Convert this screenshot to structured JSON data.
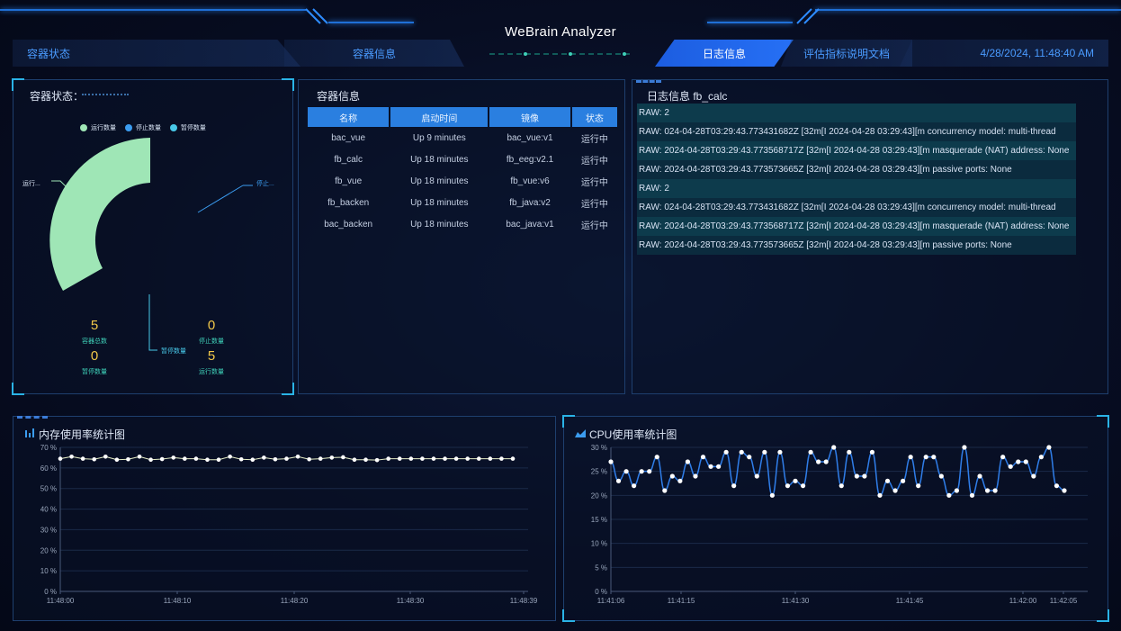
{
  "header": {
    "title": "WeBrain Analyzer",
    "datetime": "4/28/2024, 11:48:40 AM",
    "tabs": [
      {
        "label": "容器状态"
      },
      {
        "label": "容器信息"
      },
      {
        "label": "日志信息"
      },
      {
        "label": "评估指标说明文档"
      }
    ],
    "active_tab": "日志信息"
  },
  "status_panel": {
    "title": "容器状态：",
    "legend": [
      {
        "label": "运行数量",
        "color": "#9fe6b6"
      },
      {
        "label": "停止数量",
        "color": "#3b9cf0"
      },
      {
        "label": "暂停数量",
        "color": "#48c8e8"
      }
    ],
    "pie_labels": {
      "running": "运行...",
      "stopped": "停止..."
    },
    "chart_data": {
      "type": "pie",
      "categories": [
        "运行数量",
        "停止数量",
        "暂停数量"
      ],
      "values": [
        5,
        0,
        0
      ]
    },
    "stats": [
      {
        "value": "5",
        "label": "容器总数"
      },
      {
        "value": "0",
        "label": "停止数量"
      },
      {
        "value": "0",
        "label": "暂停数量"
      },
      {
        "value": "5",
        "label": "运行数量"
      }
    ],
    "paused_callout": "暂停数量"
  },
  "info_panel": {
    "title": "容器信息",
    "columns": [
      "名称",
      "启动时间",
      "镜像",
      "状态"
    ],
    "rows": [
      [
        "bac_vue",
        "Up 9 minutes",
        "bac_vue:v1",
        "运行中"
      ],
      [
        "fb_calc",
        "Up 18 minutes",
        "fb_eeg:v2.1",
        "运行中"
      ],
      [
        "fb_vue",
        "Up 18 minutes",
        "fb_vue:v6",
        "运行中"
      ],
      [
        "fb_backen",
        "Up 18 minutes",
        "fb_java:v2",
        "运行中"
      ],
      [
        "bac_backen",
        "Up 18 minutes",
        "bac_java:v1",
        "运行中"
      ]
    ]
  },
  "log_panel": {
    "title": "日志信息 fb_calc",
    "lines": [
      "RAW: 2",
      "RAW: 024-04-28T03:29:43.773431682Z [32m[I 2024-04-28 03:29:43]\u001b[m concurrency model: multi-thread",
      "RAW: 2024-04-28T03:29:43.773568717Z [32m[I 2024-04-28 03:29:43]\u001b[m masquerade (NAT) address: None",
      "RAW: 2024-04-28T03:29:43.773573665Z [32m[I 2024-04-28 03:29:43]\u001b[m passive ports: None",
      "RAW: 2",
      "RAW: 024-04-28T03:29:43.773431682Z [32m[I 2024-04-28 03:29:43]\u001b[m concurrency model: multi-thread",
      "RAW: 2024-04-28T03:29:43.773568717Z [32m[I 2024-04-28 03:29:43]\u001b[m masquerade (NAT) address: None",
      "RAW: 2024-04-28T03:29:43.773573665Z [32m[I 2024-04-28 03:29:43]\u001b[m passive ports: None"
    ]
  },
  "charts": [
    {
      "title": "内存使用率统计图",
      "chart_data": {
        "type": "line",
        "ylim": [
          0,
          70
        ],
        "yticks": [
          "0 %",
          "10 %",
          "20 %",
          "30 %",
          "40 %",
          "50 %",
          "60 %",
          "70 %"
        ],
        "xticks": [
          "11:48:00",
          "11:48:10",
          "11:48:20",
          "11:48:30",
          "11:48:39"
        ],
        "x_range_seconds": [
          0,
          39
        ],
        "color": "#e8f0c8",
        "values": [
          64.5,
          65.5,
          64.5,
          64.2,
          65.5,
          64,
          64.2,
          65.5,
          64,
          64.3,
          65,
          64.5,
          64.5,
          64,
          64,
          65.5,
          64.2,
          64,
          65,
          64.2,
          64.5,
          65.5,
          64.2,
          64.5,
          65,
          65.2,
          64,
          64,
          63.8,
          64.5,
          64.5,
          64.5,
          64.5,
          64.5,
          64.5,
          64.5,
          64.5,
          64.5,
          64.5,
          64.5,
          64.5
        ]
      }
    },
    {
      "title": "CPU使用率统计图",
      "chart_data": {
        "type": "line",
        "ylim": [
          0,
          30
        ],
        "yticks": [
          "0 %",
          "5 %",
          "10 %",
          "15 %",
          "20 %",
          "25 %",
          "30 %"
        ],
        "xticks": [
          "11:41:06",
          "11:41:15",
          "11:41:30",
          "11:41:45",
          "11:42:00",
          "11:42:05"
        ],
        "color": "#2f7de8",
        "values": [
          27,
          23,
          25,
          22,
          25,
          25,
          28,
          21,
          24,
          23,
          27,
          24,
          28,
          26,
          26,
          29,
          22,
          29,
          28,
          24,
          29,
          20,
          29,
          22,
          23,
          22,
          29,
          27,
          27,
          30,
          22,
          29,
          24,
          24,
          29,
          20,
          23,
          21,
          23,
          28,
          22,
          28,
          28,
          24,
          20,
          21,
          30,
          20,
          24,
          21,
          21,
          28,
          26,
          27,
          27,
          24,
          28,
          30,
          22,
          21
        ]
      }
    }
  ]
}
